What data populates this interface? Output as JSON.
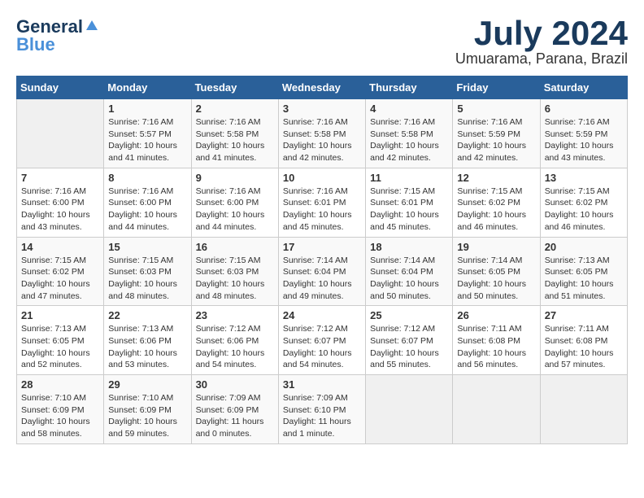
{
  "logo": {
    "general": "General",
    "blue": "Blue"
  },
  "title": {
    "month_year": "July 2024",
    "location": "Umuarama, Parana, Brazil"
  },
  "weekdays": [
    "Sunday",
    "Monday",
    "Tuesday",
    "Wednesday",
    "Thursday",
    "Friday",
    "Saturday"
  ],
  "weeks": [
    [
      {
        "day": "",
        "info": ""
      },
      {
        "day": "1",
        "info": "Sunrise: 7:16 AM\nSunset: 5:57 PM\nDaylight: 10 hours\nand 41 minutes."
      },
      {
        "day": "2",
        "info": "Sunrise: 7:16 AM\nSunset: 5:58 PM\nDaylight: 10 hours\nand 41 minutes."
      },
      {
        "day": "3",
        "info": "Sunrise: 7:16 AM\nSunset: 5:58 PM\nDaylight: 10 hours\nand 42 minutes."
      },
      {
        "day": "4",
        "info": "Sunrise: 7:16 AM\nSunset: 5:58 PM\nDaylight: 10 hours\nand 42 minutes."
      },
      {
        "day": "5",
        "info": "Sunrise: 7:16 AM\nSunset: 5:59 PM\nDaylight: 10 hours\nand 42 minutes."
      },
      {
        "day": "6",
        "info": "Sunrise: 7:16 AM\nSunset: 5:59 PM\nDaylight: 10 hours\nand 43 minutes."
      }
    ],
    [
      {
        "day": "7",
        "info": "Sunrise: 7:16 AM\nSunset: 6:00 PM\nDaylight: 10 hours\nand 43 minutes."
      },
      {
        "day": "8",
        "info": "Sunrise: 7:16 AM\nSunset: 6:00 PM\nDaylight: 10 hours\nand 44 minutes."
      },
      {
        "day": "9",
        "info": "Sunrise: 7:16 AM\nSunset: 6:00 PM\nDaylight: 10 hours\nand 44 minutes."
      },
      {
        "day": "10",
        "info": "Sunrise: 7:16 AM\nSunset: 6:01 PM\nDaylight: 10 hours\nand 45 minutes."
      },
      {
        "day": "11",
        "info": "Sunrise: 7:15 AM\nSunset: 6:01 PM\nDaylight: 10 hours\nand 45 minutes."
      },
      {
        "day": "12",
        "info": "Sunrise: 7:15 AM\nSunset: 6:02 PM\nDaylight: 10 hours\nand 46 minutes."
      },
      {
        "day": "13",
        "info": "Sunrise: 7:15 AM\nSunset: 6:02 PM\nDaylight: 10 hours\nand 46 minutes."
      }
    ],
    [
      {
        "day": "14",
        "info": "Sunrise: 7:15 AM\nSunset: 6:02 PM\nDaylight: 10 hours\nand 47 minutes."
      },
      {
        "day": "15",
        "info": "Sunrise: 7:15 AM\nSunset: 6:03 PM\nDaylight: 10 hours\nand 48 minutes."
      },
      {
        "day": "16",
        "info": "Sunrise: 7:15 AM\nSunset: 6:03 PM\nDaylight: 10 hours\nand 48 minutes."
      },
      {
        "day": "17",
        "info": "Sunrise: 7:14 AM\nSunset: 6:04 PM\nDaylight: 10 hours\nand 49 minutes."
      },
      {
        "day": "18",
        "info": "Sunrise: 7:14 AM\nSunset: 6:04 PM\nDaylight: 10 hours\nand 50 minutes."
      },
      {
        "day": "19",
        "info": "Sunrise: 7:14 AM\nSunset: 6:05 PM\nDaylight: 10 hours\nand 50 minutes."
      },
      {
        "day": "20",
        "info": "Sunrise: 7:13 AM\nSunset: 6:05 PM\nDaylight: 10 hours\nand 51 minutes."
      }
    ],
    [
      {
        "day": "21",
        "info": "Sunrise: 7:13 AM\nSunset: 6:05 PM\nDaylight: 10 hours\nand 52 minutes."
      },
      {
        "day": "22",
        "info": "Sunrise: 7:13 AM\nSunset: 6:06 PM\nDaylight: 10 hours\nand 53 minutes."
      },
      {
        "day": "23",
        "info": "Sunrise: 7:12 AM\nSunset: 6:06 PM\nDaylight: 10 hours\nand 54 minutes."
      },
      {
        "day": "24",
        "info": "Sunrise: 7:12 AM\nSunset: 6:07 PM\nDaylight: 10 hours\nand 54 minutes."
      },
      {
        "day": "25",
        "info": "Sunrise: 7:12 AM\nSunset: 6:07 PM\nDaylight: 10 hours\nand 55 minutes."
      },
      {
        "day": "26",
        "info": "Sunrise: 7:11 AM\nSunset: 6:08 PM\nDaylight: 10 hours\nand 56 minutes."
      },
      {
        "day": "27",
        "info": "Sunrise: 7:11 AM\nSunset: 6:08 PM\nDaylight: 10 hours\nand 57 minutes."
      }
    ],
    [
      {
        "day": "28",
        "info": "Sunrise: 7:10 AM\nSunset: 6:09 PM\nDaylight: 10 hours\nand 58 minutes."
      },
      {
        "day": "29",
        "info": "Sunrise: 7:10 AM\nSunset: 6:09 PM\nDaylight: 10 hours\nand 59 minutes."
      },
      {
        "day": "30",
        "info": "Sunrise: 7:09 AM\nSunset: 6:09 PM\nDaylight: 11 hours\nand 0 minutes."
      },
      {
        "day": "31",
        "info": "Sunrise: 7:09 AM\nSunset: 6:10 PM\nDaylight: 11 hours\nand 1 minute."
      },
      {
        "day": "",
        "info": ""
      },
      {
        "day": "",
        "info": ""
      },
      {
        "day": "",
        "info": ""
      }
    ]
  ]
}
